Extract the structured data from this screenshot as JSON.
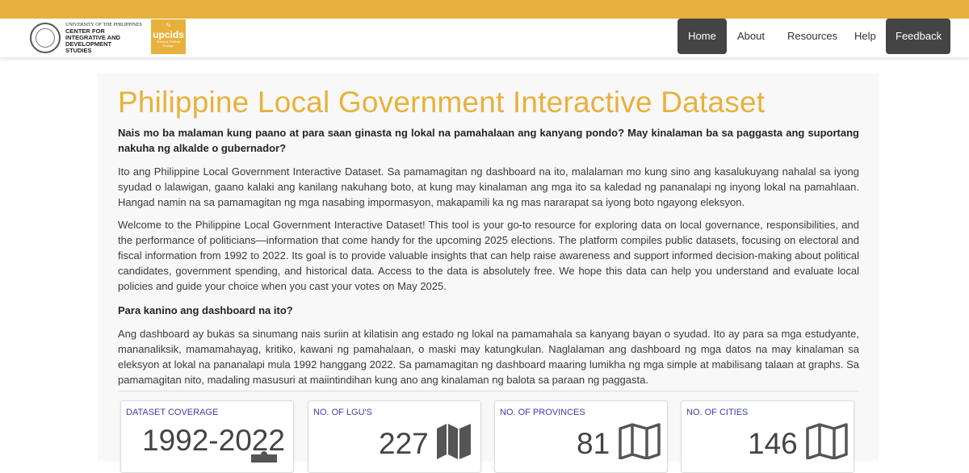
{
  "header": {
    "brand_colors": {
      "accent": "#e8b13c",
      "nav_dark": "#444444",
      "stat_label": "#3e3ea8"
    },
    "logo_text": {
      "university": "UNIVERSITY OF THE PHILIPPINES",
      "line1": "CENTER FOR",
      "line2": "INTEGRATIVE AND",
      "line3": "DEVELOPMENT",
      "line4": "STUDIES"
    },
    "upcids_logo": {
      "brand": "upcids",
      "tagline": "Social & Political Change"
    },
    "nav": {
      "home": "Home",
      "about": "About",
      "resources": "Resources",
      "help": "Help",
      "feedback": "Feedback"
    }
  },
  "main": {
    "title": "Philippine Local Government Interactive Dataset",
    "lead": "Nais mo ba malaman kung paano at para saan ginasta ng lokal na pamahalaan ang kanyang pondo? May kinalaman ba sa paggasta ang suportang nakuha ng alkalde o gubernador?",
    "paragraph_fil": "Ito ang Philippine Local Government Interactive Dataset. Sa pamamagitan ng dashboard na ito, malalaman mo kung sino ang kasalukuyang nahalal sa iyong syudad o lalawigan, gaano kalaki ang kanilang nakuhang boto, at kung may kinalaman ang mga ito sa kaledad ng pananalapi ng inyong lokal na pamahlaan. Hangad namin na sa pamamagitan ng mga nasabing impormasyon, makapamili ka ng mas nararapat sa iyong boto ngayong eleksyon.",
    "paragraph_en": "Welcome to the Philippine Local Government Interactive Dataset! This tool is your go-to resource for exploring data on local governance, responsibilities, and the performance of politicians—information that come handy for the upcoming 2025 elections. The platform compiles public datasets, focusing on electoral and fiscal information from 1992 to 2022. Its goal is to provide valuable insights that can help raise awareness and support informed decision-making about political candidates, government spending, and historical data. Access to the data is absolutely free. We hope this data can help you understand and evaluate local policies and guide your choice when you cast your votes on May 2025.",
    "subheading": "Para kanino ang dashboard na ito?",
    "paragraph_audience": "Ang dashboard ay bukas sa sinumang nais suriin at kilatisin ang estado ng lokal na pamamahala sa kanyang bayan o syudad. Ito ay para sa mga estudyante, mananaliksik, mamamahayag, kritiko, kawani ng pamahalaan, o maski may katungkulan. Naglalaman ang dashboard ng mga datos na may kinalaman sa eleksyon at lokal na pananalapi mula 1992 hanggang 2022. Sa pamamagitan ng dashboard maaring lumikha ng mga simple at mabilisang talaan at graphs. Sa pamamagitan nito, madaling masusuri at maiintindihan kung ano ang kinalaman ng balota sa paraan ng paggasta."
  },
  "stats": [
    {
      "label": "DATASET COVERAGE",
      "value": "1992-2022",
      "icon": "puzzle-icon"
    },
    {
      "label": "NO. OF LGU'S",
      "value": "227",
      "icon": "map-filled-icon"
    },
    {
      "label": "NO. OF PROVINCES",
      "value": "81",
      "icon": "map-outline-icon"
    },
    {
      "label": "NO. OF CITIES",
      "value": "146",
      "icon": "map-outline-icon"
    }
  ]
}
